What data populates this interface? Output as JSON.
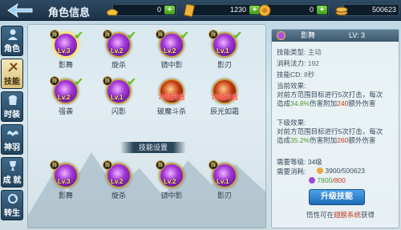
{
  "header": {
    "title": "角色信息",
    "currencies": [
      {
        "name": "gold-ingot",
        "value": "0"
      },
      {
        "name": "ticket",
        "value": "1230"
      },
      {
        "name": "coin",
        "value": "0"
      },
      {
        "name": "silver",
        "value": "500623"
      }
    ],
    "plus_label": "+"
  },
  "sidebar": {
    "tabs": [
      {
        "label": "角色",
        "active": false
      },
      {
        "label": "技能",
        "active": true
      },
      {
        "label": "时装",
        "active": false
      },
      {
        "label": "神羽",
        "active": false
      },
      {
        "label": "成 就",
        "active": false
      },
      {
        "label": "转生",
        "active": false
      }
    ]
  },
  "skills": {
    "grid": [
      {
        "name": "影舞",
        "lv": "Lv.3",
        "badge": "舞",
        "selected": true,
        "color": "purple"
      },
      {
        "name": "旋杀",
        "lv": "Lv.2",
        "badge": "舞",
        "color": "purple"
      },
      {
        "name": "镜中影",
        "lv": "Lv.2",
        "badge": "舞",
        "color": "purple"
      },
      {
        "name": "影刃",
        "lv": "Lv.1",
        "badge": "舞",
        "color": "purple"
      },
      {
        "name": "强袭",
        "lv": "Lv.2",
        "badge": "舞",
        "color": "purple"
      },
      {
        "name": "闪影",
        "lv": "Lv.1",
        "badge": "舞",
        "color": "purple"
      },
      {
        "name": "破魔斗杀",
        "lv": "70级开启",
        "badge": "",
        "color": "red",
        "locked": true
      },
      {
        "name": "辰光如霜",
        "lv": "75级开启",
        "badge": "",
        "color": "red",
        "locked": true
      }
    ],
    "settings_title": "技能设置",
    "equipped": [
      {
        "name": "影舞",
        "lv": "Lv.3",
        "badge": "舞"
      },
      {
        "name": "旋杀",
        "lv": "Lv.2",
        "badge": "舞"
      },
      {
        "name": "镜中影",
        "lv": "Lv.2",
        "badge": "舞"
      },
      {
        "name": "影刃",
        "lv": "Lv.1",
        "badge": "舞"
      }
    ]
  },
  "info": {
    "name": "影舞",
    "level": "LV: 3",
    "type_label": "技能类型:",
    "type_value": "主动",
    "cost_label": "消耗法力:",
    "cost_value": "192",
    "cd_label": "技能CD:",
    "cd_value": "8秒",
    "current_title": "当前效果:",
    "current_1": "对前方范围目标进行5次打击，每次",
    "current_2a": "造成",
    "current_2b": "34.8%",
    "current_2c": "伤害附加",
    "current_2d": "240",
    "current_2e": "额外伤害",
    "next_title": "下级效果:",
    "next_1": "对前方范围目标进行5次打击，每次",
    "next_2a": "造成",
    "next_2b": "35.2%",
    "next_2c": "伤害附加",
    "next_2d": "260",
    "next_2e": "额外伤害",
    "need_level": "需要等级: 34级",
    "need_cost_label": "需要消耗:",
    "need_cost_1": "3900/500623",
    "need_cost_2a": "7800",
    "need_cost_2b": "/800",
    "upgrade_label": "升级技能",
    "foot_a": "悟性可在",
    "foot_b": "翅膀系统",
    "foot_c": "获得"
  }
}
